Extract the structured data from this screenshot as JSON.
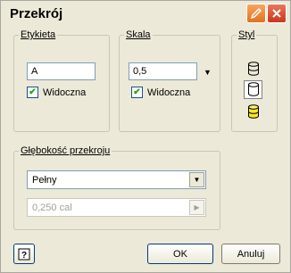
{
  "window": {
    "title": "Przekrój"
  },
  "etykieta": {
    "group_label": "Etykieta",
    "value": "A",
    "visible_label": "Widoczna",
    "visible_checked": true
  },
  "skala": {
    "group_label": "Skala",
    "value": "0,5",
    "visible_label": "Widoczna",
    "visible_checked": true
  },
  "styl": {
    "group_label": "Styl",
    "buttons": [
      "cylinder-outline-icon",
      "cylinder-pressed-icon",
      "cylinder-yellow-icon"
    ]
  },
  "glebokosc": {
    "group_label": "Głębokość przekroju",
    "selected": "Pełny",
    "depth_value": "0,250 cal"
  },
  "footer": {
    "ok_label": "OK",
    "cancel_label": "Anuluj"
  },
  "colors": {
    "dialog_bg": "#ece9d8",
    "accent_yellow": "#f6e626",
    "input_border": "#7f9db9"
  }
}
